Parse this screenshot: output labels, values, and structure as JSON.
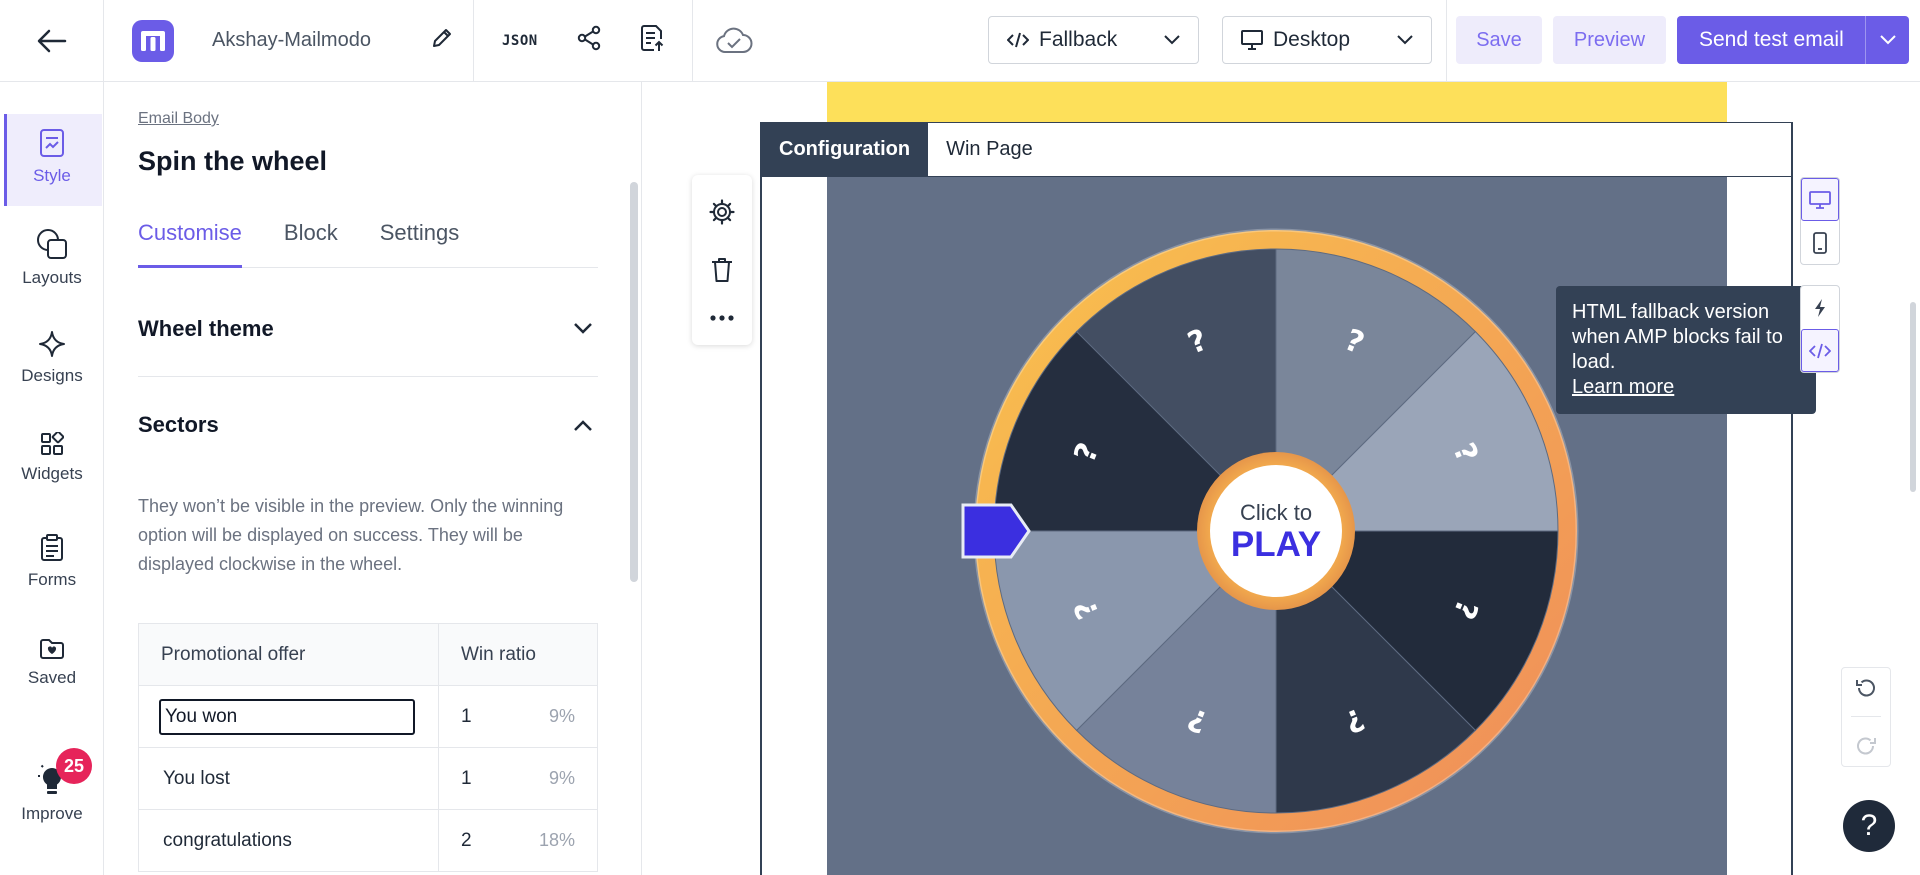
{
  "header": {
    "project_name": "Akshay-Mailmodo",
    "json_label": "JSON",
    "version_select": "Fallback",
    "device_select": "Desktop",
    "save_label": "Save",
    "preview_label": "Preview",
    "send_label": "Send test email"
  },
  "leftnav": {
    "items": [
      {
        "label": "Style",
        "icon": "style-icon"
      },
      {
        "label": "Layouts",
        "icon": "layouts-icon"
      },
      {
        "label": "Designs",
        "icon": "designs-icon"
      },
      {
        "label": "Widgets",
        "icon": "widgets-icon"
      },
      {
        "label": "Forms",
        "icon": "forms-icon"
      },
      {
        "label": "Saved",
        "icon": "saved-icon"
      },
      {
        "label": "Improve",
        "icon": "bulb-icon"
      }
    ],
    "improve_badge": "25"
  },
  "panel": {
    "breadcrumb": "Email Body",
    "title": "Spin the wheel",
    "tabs": [
      "Customise",
      "Block",
      "Settings"
    ],
    "wheel_theme_label": "Wheel theme",
    "sectors_label": "Sectors",
    "sectors_hint": "They won’t be visible in the preview. Only the winning option will be displayed on success. They will be displayed clockwise in the wheel.",
    "table": {
      "col_offer": "Promotional offer",
      "col_ratio": "Win ratio",
      "rows": [
        {
          "offer": "You won",
          "ratio": "1",
          "pct": "9%"
        },
        {
          "offer": "You lost",
          "ratio": "1",
          "pct": "9%"
        },
        {
          "offer": "congratulations",
          "ratio": "2",
          "pct": "18%"
        }
      ]
    }
  },
  "canvas": {
    "tab_config": "Configuration",
    "tab_win": "Win Page",
    "wheel": {
      "center_small": "Click to",
      "center_big": "PLAY",
      "sector_glyph": "?"
    },
    "tooltip_text": "HTML fallback version when AMP blocks fail to load.",
    "tooltip_link": "Learn more",
    "help_label": "?"
  },
  "colors": {
    "accent": "#6b5ce7",
    "game_bg": "#637087",
    "wheel_ring": "#f5a94a",
    "pointer": "#3b2fe0",
    "yellow_strip": "#fde05a"
  }
}
